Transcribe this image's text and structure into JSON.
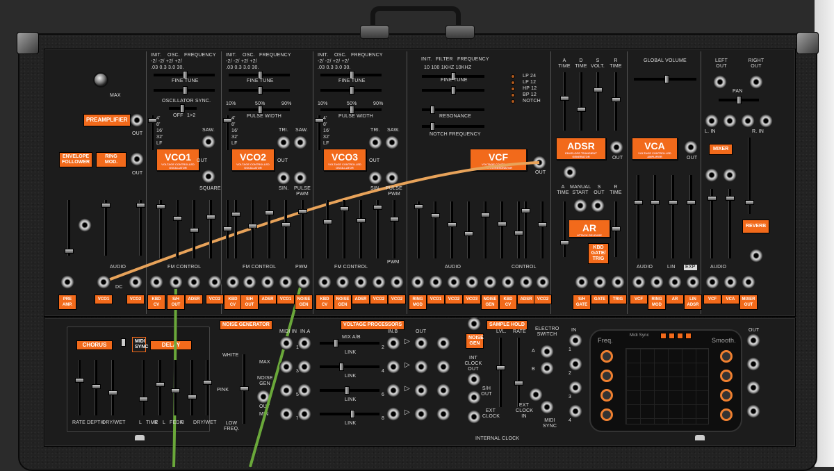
{
  "preamp": {
    "label": "PREAMPLIFIER",
    "max": "MAX",
    "out": "OUT"
  },
  "env_follower": {
    "label": "ENVELOPE FOLLOWER",
    "ring": "RING MOD.",
    "out": "OUT",
    "audio": "AUDIO",
    "dc": "DC"
  },
  "vco_common": {
    "init": "INIT.",
    "osc": "OSC.",
    "freq": "FREQUENCY",
    "fine_tune": "FINE TUNE",
    "fm_control": "FM CONTROL",
    "pulse_width": "PULSE WIDTH",
    "tri": "TRI.",
    "saw": "SAW.",
    "sin": "SIN.",
    "pulse_pwm": "PULSE PWM",
    "out": "OUT",
    "square": "SQUARE",
    "pwm": "PWM",
    "sub": "VOLTAGE CONTROLLED OSCILLATOR",
    "osc_sync": "OSCILLATOR SYNC.",
    "off": "OFF",
    "one_two": "1>2",
    "p10": "10%",
    "p50": "50%",
    "p90": "90%"
  },
  "vco_scale": {
    "r1": "-2/  -2/  +2/  +2/",
    "r2": ".03  0.3  3.0  30."
  },
  "octaves": [
    "4'",
    "8'",
    "16'",
    "32'",
    "LF"
  ],
  "vcos": [
    {
      "name": "VCO1"
    },
    {
      "name": "VCO2"
    },
    {
      "name": "VCO3"
    }
  ],
  "vcf": {
    "name": "VCF",
    "sub": "VOLTAGE CONTROLLED FILTER/RESONATOR",
    "init": "INIT.",
    "filter": "FILTER",
    "freq": "FREQUENCY",
    "r1": "10   100  1KHZ   10KHZ",
    "fine_tune": "FINE TUNE",
    "resonance": "RESONANCE",
    "notch": "NOTCH FREQUENCY",
    "out": "OUT",
    "audio": "AUDIO",
    "control": "CONTROL"
  },
  "filter_modes": [
    "LP  24",
    "LP  12",
    "HP  12",
    "BP  12",
    "NOTCH"
  ],
  "adsr": {
    "name": "ADSR",
    "sub": "ENVELOPE TRANSIENT GENERATOR",
    "a": "A TIME",
    "d": "D TIME",
    "s": "S VOLT.",
    "r": "R TIME",
    "out": "OUT"
  },
  "ar": {
    "name": "AR",
    "sub": "ATTACK RELEASE",
    "a": "A TIME",
    "manual": "MANUAL START",
    "s_out": "S OUT",
    "r": "R TIME",
    "kbd": "KBD GATE/ TRIG"
  },
  "vca": {
    "name": "VCA",
    "sub": "VOLTAGE CONTROLLED AMPLIFIER",
    "global": "GLOBAL VOLUME",
    "out": "OUT",
    "audio": "AUDIO",
    "lin": "LIN",
    "exp": "EXP"
  },
  "mixer": {
    "left": "LEFT OUT",
    "right": "RIGHT OUT",
    "pan": "PAN",
    "lin": "L. IN",
    "rin": "R. IN",
    "name": "MIXER",
    "reverb": "REVERB",
    "audio": "AUDIO"
  },
  "bottom_labels": [
    "PRE AMP.",
    "VCO1",
    "VCO2",
    "KBD CV",
    "S/H OUT",
    "ADSR",
    "VCO2",
    "KBD CV",
    "S/H OUT",
    "ADSR",
    "VCO1",
    "NOISE GEN",
    "KBD CV",
    "NOISE GEN",
    "ADSR",
    "VCO2",
    "VCO2",
    "RING MOD",
    "VCO1",
    "VCO2",
    "VCO3",
    "NOISE GEN",
    "KBD CV",
    "ADSR",
    "VCO2",
    "S/H GATE",
    "GATE",
    "TRIG",
    "VCF",
    "RING MOD",
    "AR",
    "LIN ADSR",
    "VCF",
    "VCA",
    "MIXER OUT"
  ],
  "fx": {
    "chorus": "CHORUS",
    "delay": "DELAY",
    "midi_sync": "MIDI SYNC",
    "labels": [
      "RATE",
      "DEPTH",
      "DRY/WET",
      "L",
      "TIME",
      "R",
      "L",
      "FEDK",
      "R",
      "DRY/WET"
    ]
  },
  "noise": {
    "title": "NOISE GENERATOR",
    "white": "WHITE",
    "pink": "PINK",
    "low": "LOW FREQ.",
    "max": "MAX",
    "gen": "NOISE GEN",
    "out": "OUT",
    "min": "MIN"
  },
  "vp": {
    "title": "VOLTAGE PROCESSORS",
    "midi_in": "MIDI IN",
    "in_a": "IN.A",
    "mix": "MIX A/B",
    "in_b": "IN.B",
    "out": "OUT",
    "link": "LINK",
    "nums": [
      "1",
      "2",
      "3",
      "4",
      "5",
      "6",
      "7",
      "8"
    ]
  },
  "sh": {
    "title": "SAMPLE HOLD",
    "noise": "NOISE GEN",
    "lvl": "LVL.",
    "rate": "RATE",
    "electro": "ELECTRO SWITCH",
    "int_clock": "INT CLOCK OUT",
    "sh_out": "S/H OUT",
    "ext_clock": "EXT CLOCK",
    "ext_clock_in": "EXT CLOCK IN",
    "midi_sync": "MIDI SYNC",
    "internal": "INTERNAL CLOCK",
    "a": "A",
    "b": "B"
  },
  "lfo_screen": {
    "in": "IN",
    "out": "OUT",
    "freq": "Freq.",
    "midi_sync": "Midi Sync",
    "smooth": "Smooth.",
    "nums": [
      "1",
      "2",
      "3",
      "4"
    ]
  },
  "colors": {
    "accent": "#f26a1b",
    "panel": "#1c1c1c",
    "cable_orange": "#e8a35a",
    "cable_green": "#6aa83a"
  }
}
